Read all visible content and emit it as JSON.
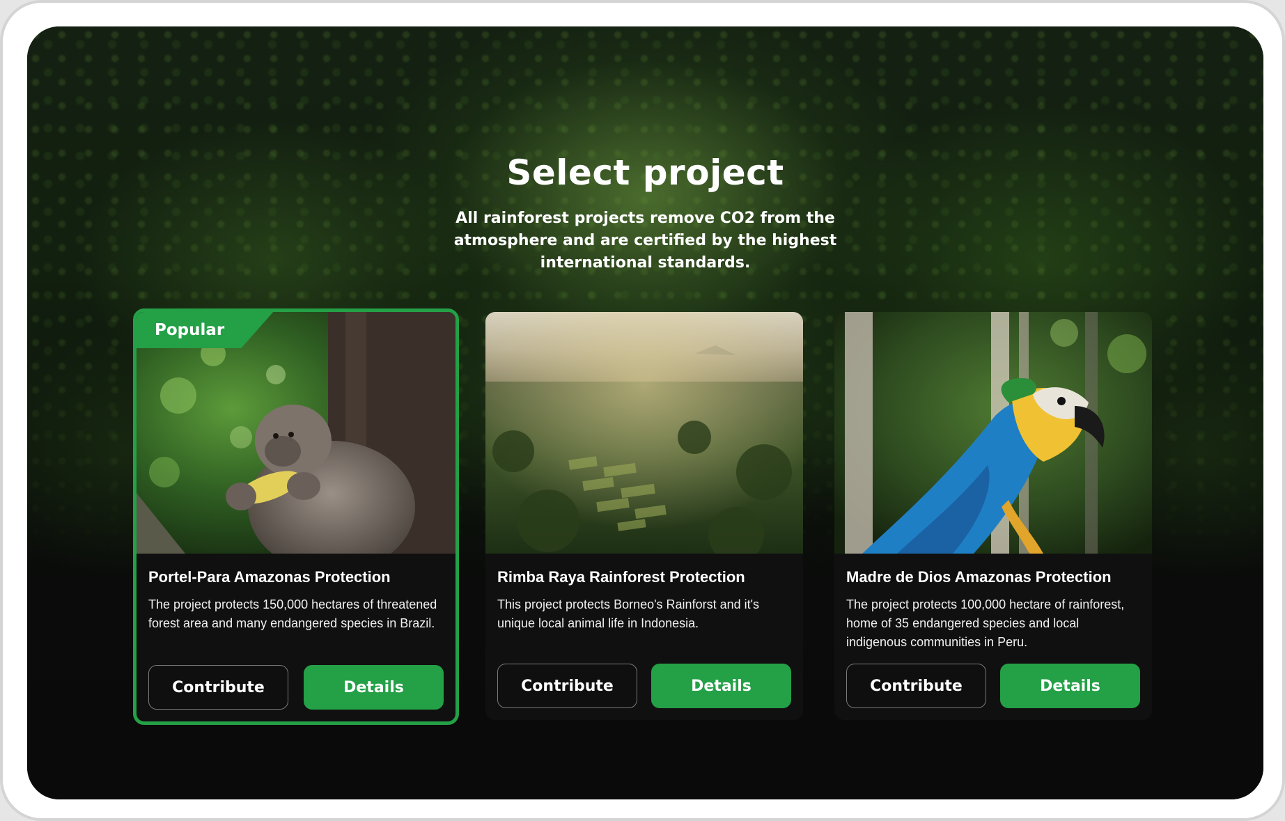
{
  "header": {
    "title": "Select project",
    "subtitle": "All rainforest projects remove CO2 from the atmosphere and are certified by the highest international standards."
  },
  "colors": {
    "accent": "#24a047",
    "background": "#0b0c0b",
    "card": "#101010"
  },
  "projects": [
    {
      "badge": "Popular",
      "image": "monkey-eating-corn-photo",
      "title": "Portel-Para Amazonas Protection",
      "description": "The project protects 150,000 hectares of threatened forest area and many endangered species in Brazil.",
      "contribute_label": "Contribute",
      "details_label": "Details"
    },
    {
      "badge": "",
      "image": "rainforest-aerial-rice-terraces-photo",
      "title": "Rimba Raya Rainforest Protection",
      "description": "This project protects Borneo's Rainforst and it's unique local animal life in Indonesia.",
      "contribute_label": "Contribute",
      "details_label": "Details"
    },
    {
      "badge": "",
      "image": "blue-and-yellow-macaw-photo",
      "title": "Madre de Dios Amazonas Protection",
      "description": "The project protects 100,000 hectare of rainforest, home of 35 endangered species and local indigenous communities in Peru.",
      "contribute_label": "Contribute",
      "details_label": "Details"
    }
  ]
}
